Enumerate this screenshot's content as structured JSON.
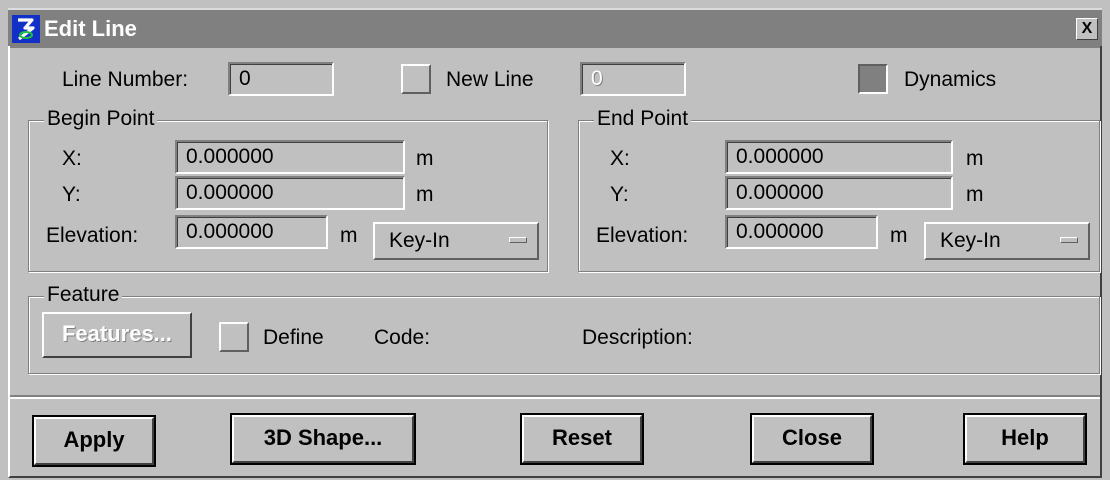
{
  "window": {
    "title": "Edit Line",
    "close_glyph": "X",
    "icon": "microstation-b-icon"
  },
  "top_row": {
    "line_number_label": "Line Number:",
    "line_number_value": "0",
    "new_line_label": "New Line",
    "new_line_checked": false,
    "new_line_value": "0",
    "dynamics_label": "Dynamics",
    "dynamics_checked": true
  },
  "begin_point": {
    "title": "Begin Point",
    "x_label": "X:",
    "x_value": "0.000000",
    "x_unit": "m",
    "y_label": "Y:",
    "y_value": "0.000000",
    "y_unit": "m",
    "elevation_label": "Elevation:",
    "elevation_value": "0.000000",
    "elevation_unit": "m",
    "mode": "Key-In"
  },
  "end_point": {
    "title": "End Point",
    "x_label": "X:",
    "x_value": "0.000000",
    "x_unit": "m",
    "y_label": "Y:",
    "y_value": "0.000000",
    "y_unit": "m",
    "elevation_label": "Elevation:",
    "elevation_value": "0.000000",
    "elevation_unit": "m",
    "mode": "Key-In"
  },
  "feature": {
    "title": "Feature",
    "features_button": "Features...",
    "define_label": "Define",
    "define_checked": false,
    "code_label": "Code:",
    "description_label": "Description:"
  },
  "buttons": {
    "apply": "Apply",
    "shape3d": "3D Shape...",
    "reset": "Reset",
    "close": "Close",
    "help": "Help"
  }
}
